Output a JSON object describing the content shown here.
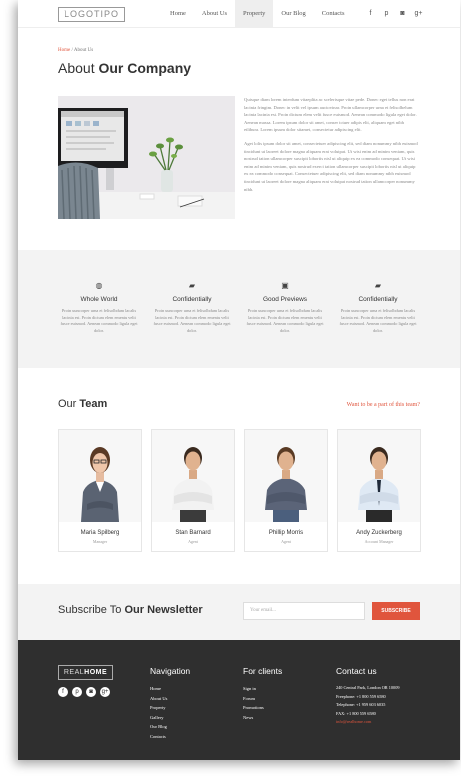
{
  "header": {
    "logo": "LOGOTIPO",
    "nav": [
      "Home",
      "About Us",
      "Property",
      "Our Blog",
      "Contacts"
    ],
    "active_nav": "Property",
    "social": [
      "f",
      "p",
      "◙",
      "g+"
    ]
  },
  "breadcrumb": {
    "home": "Home",
    "separator": " / ",
    "current": "About Us"
  },
  "title": {
    "light": "About ",
    "bold": "Our Company"
  },
  "about": {
    "paragraph1": "Quisque diam lorem interdum vitaeplita ac scelerisque vitae pede. Donec eget tellus non erat lacinia fringtm. Donec in velit vel ipsum auctovinar. Proin ullamcorper urna et felisolbelum lacinia lacinia est. Proin dictum elem velit fusce euismod. Aenean commodo ligula eget dolor. Aenean massa. Lorem ipsum dolor sit amet, conser tctuer adipis elit, aliquam eget nibh etlibura. Lorem ipsum dolor sitamet, consectetur adipiscing elit.",
    "paragraph2": "Aget lolis ipsum dolor sit amet, consectetuer adipiscing elit, sed diam nonummy nibh euismod tincidunt ut laoreet dolore magna aliquam erat volutpat. Ut wisi enim ad minim veniam, quis nostrud tation ullamcorper suscipit lobortis nisl ut aliquip ex ea commodo consequat. Ut wisi enim ad minim veniam, quis nostrud exerci tation ullamcorper suscipit lobortis nisl ut aliquip ex ea commodo consequat. Consectetuer adipiscing elit, sed diam nonummy nibh euismod tincidunt ut laoreet dolore magna aliquam erat volutpat nostrud tation ullamcorper nonummy nibh."
  },
  "features": [
    {
      "icon": "globe-icon",
      "glyph": "◍",
      "title": "Whole World",
      "text": "Proin uuncorper urna et felisolbdum lacalis lacinia est. Proin dictum elem ementu velit fusce euismod. Aenean commodo ligula eget dolor."
    },
    {
      "icon": "briefcase-icon",
      "glyph": "▰",
      "title": "Confidentially",
      "text": "Proin uuncorper urna et felisolbdum lacalis lacinia est. Proin dictum elem ementu velit fusce euismod. Aenean commodo ligula eget dolor."
    },
    {
      "icon": "image-icon",
      "glyph": "▣",
      "title": "Good Previews",
      "text": "Proin uuncorper urna et felisolbdum lacalis lacinia est. Proin dictum elem ementu velit fusce euismod. Aenean commodo ligula eget dolor."
    },
    {
      "icon": "briefcase-icon",
      "glyph": "▰",
      "title": "Confidentially",
      "text": "Proin uuncorper urna et felisolbdum lacalis lacinia est. Proin dictum elem ementu velit fusce euismod. Aenean commodo ligula eget dolor."
    }
  ],
  "team": {
    "title_light": "Our ",
    "title_bold": "Team",
    "link": "Want to be a part of this team?",
    "members": [
      {
        "name": "Maria Spilberg",
        "role": "Manager"
      },
      {
        "name": "Stan Barnard",
        "role": "Agent"
      },
      {
        "name": "Phillip Morris",
        "role": "Agent"
      },
      {
        "name": "Andy Zuckerberg",
        "role": "Account Manager"
      }
    ]
  },
  "newsletter": {
    "title_light": "Subscribe To ",
    "title_bold": "Our Newsletter",
    "placeholder": "Your email...",
    "button": "SUBSCRIBE"
  },
  "footer": {
    "logo_light": "REAL",
    "logo_bold": "HOME",
    "social": [
      "f",
      "p",
      "◙",
      "g+"
    ],
    "nav_title": "Navigation",
    "nav_items": [
      "Home",
      "About Us",
      "Property",
      "Gallery",
      "Our Blog",
      "Contacts"
    ],
    "clients_title": "For clients",
    "clients_items": [
      "Sign in",
      "Forum",
      "Promotions",
      "News"
    ],
    "contact_title": "Contact us",
    "address": "240 Central Park, London OR 10009",
    "freephone": "Freephone: +1 800 559 6580",
    "telephone": "Telephone: +1 959 603 6035",
    "fax": "FAX: +1 800 559 6580",
    "email": "info@realhome.com"
  },
  "colors": {
    "accent": "#e0553d",
    "footer_bg": "#2f2f2f",
    "section_bg": "#f3f3f3"
  }
}
